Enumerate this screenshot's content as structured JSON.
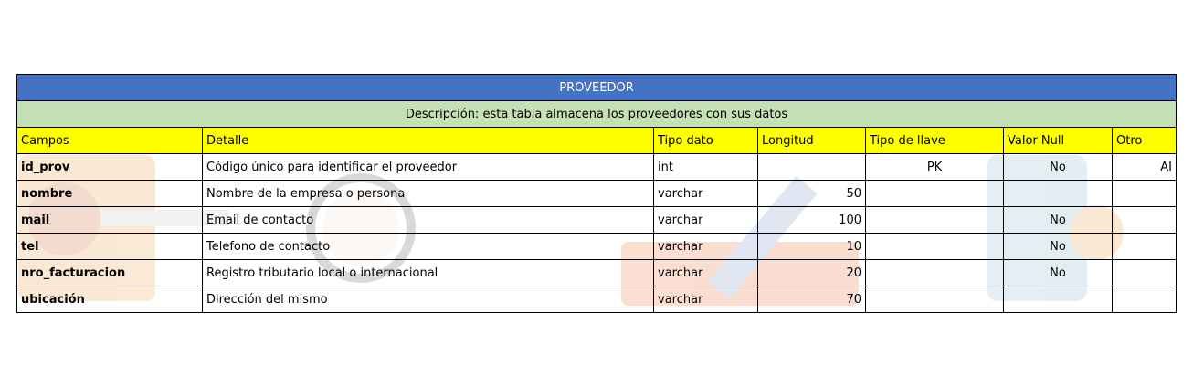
{
  "table": {
    "title": "PROVEEDOR",
    "description": "Descripción: esta tabla almacena los proveedores con sus datos",
    "headers": [
      "Campos",
      "Detalle",
      "Tipo dato",
      "Longitud",
      "Tipo de llave",
      "Valor Null",
      "Otro"
    ],
    "rows": [
      [
        "id_prov",
        "Código único para identificar el proveedor",
        "int",
        "",
        "PK",
        "No",
        "AI"
      ],
      [
        "nombre",
        "Nombre de la empresa o persona",
        "varchar",
        "50",
        "",
        "",
        ""
      ],
      [
        "mail",
        "Email de contacto",
        "varchar",
        "100",
        "",
        "No",
        ""
      ],
      [
        "tel",
        "Telefono de contacto",
        "varchar",
        "10",
        "",
        "No",
        ""
      ],
      [
        "nro_facturacion",
        "Registro tributario local o internacional",
        "varchar",
        "20",
        "",
        "No",
        ""
      ],
      [
        "ubicación",
        "Dirección del mismo",
        "varchar",
        "70",
        "",
        "",
        ""
      ]
    ]
  },
  "colors": {
    "title_bg": "#4472c4",
    "description_bg": "#c5e0b4",
    "header_bg": "#ffff00"
  }
}
